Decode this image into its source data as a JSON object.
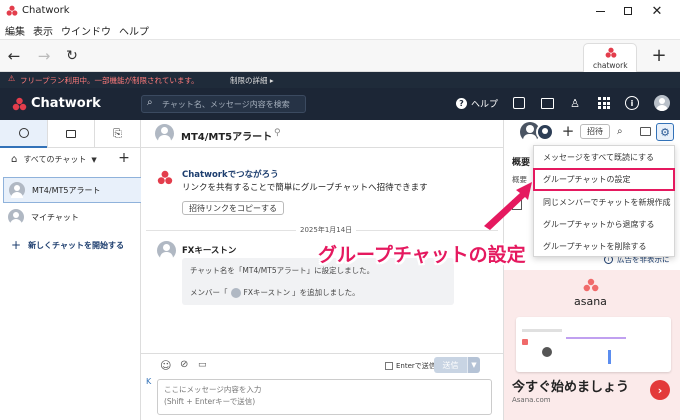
{
  "window": {
    "title": "Chatwork"
  },
  "menubar": {
    "items": [
      "編集",
      "表示",
      "ウインドウ",
      "ヘルプ"
    ]
  },
  "browser_tab": {
    "label": "chatwork"
  },
  "banner": {
    "message": "フリープラン利用中。一部機能が制限されています。",
    "details_link": "制限の詳細"
  },
  "header": {
    "brand": "Chatwork",
    "search_placeholder": "チャット名、メッセージ内容を検索",
    "help_label": "ヘルプ"
  },
  "sidebar": {
    "filter_label": "すべてのチャット",
    "items": [
      {
        "label": "MT4/MT5アラート"
      },
      {
        "label": "マイチャット"
      }
    ],
    "new_chat_label": "新しくチャットを開始する"
  },
  "chat": {
    "title": "MT4/MT5アラート",
    "invite_label": "招待",
    "invite_card": {
      "title": "Chatworkでつながろう",
      "body": "リンクを共有することで簡単にグループチャットへ招待できます",
      "copy_button": "招待リンクをコピーする"
    },
    "date_divider": "2025年1月14日",
    "message": {
      "sender": "FXキーストン",
      "line1": "チャット名を「MT4/MT5アラート」に設定しました。",
      "line2_prefix": "メンバー「",
      "line2_user": "FXキーストン",
      "line2_suffix": "」を追加しました。"
    },
    "composer": {
      "enter_send_label": "Enterで送信",
      "send_label": "送信",
      "placeholder_line1": "ここにメッセージ内容を入力",
      "placeholder_line2": "(Shift + Enterキーで送信)"
    }
  },
  "right_panel": {
    "overview_title": "概要",
    "overview_sub": "概要",
    "ad_label": "広告を非表示に",
    "ad_brand": "asana",
    "ad_headline": "今すぐ始めましょう",
    "ad_url": "Asana.com"
  },
  "dropdown": {
    "items": [
      "メッセージをすべて既読にする",
      "グループチャットの設定",
      "同じメンバーでチャットを新規作成",
      "グループチャットから退席する",
      "グループチャットを削除する"
    ]
  },
  "callout": {
    "text": "グループチャットの設定"
  },
  "colors": {
    "header_bg": "#1c2636",
    "brand_red": "#e33d4c",
    "highlight": "#e5195f",
    "link_blue": "#3372b8"
  }
}
